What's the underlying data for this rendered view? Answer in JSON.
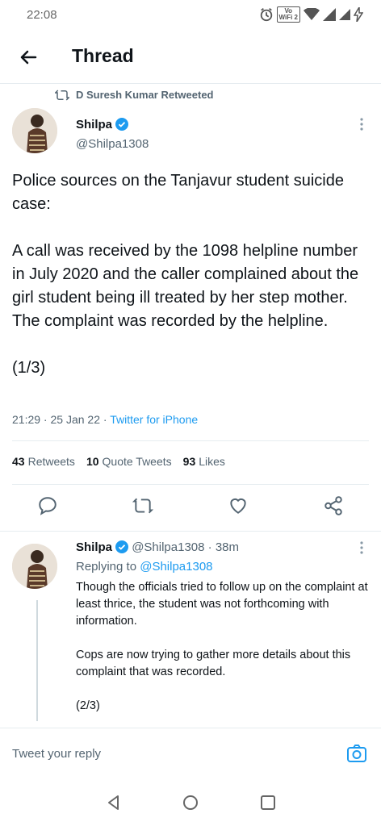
{
  "status_bar": {
    "time": "22:08",
    "volte_line1": "Vo",
    "volte_line2": "WiFi 2",
    "icons": [
      "alarm-icon",
      "volte-wifi-icon",
      "wifi-icon",
      "signal-icon",
      "signal-icon",
      "charging-icon"
    ]
  },
  "header": {
    "title": "Thread",
    "back_icon": "arrow-left-icon"
  },
  "main_tweet": {
    "retweeted_by": "D Suresh Kumar Retweeted",
    "author_name": "Shilpa",
    "author_handle": "@Shilpa1308",
    "paragraphs": [
      "Police sources on the Tanjavur student suicide case:",
      "A call was received by the 1098 helpline number in July 2020 and the caller complained about the girl student being ill treated by her step mother. The complaint was recorded by the helpline.",
      "(1/3)"
    ],
    "time": "21:29",
    "date": "25 Jan 22",
    "source": "Twitter for iPhone",
    "stats": {
      "retweets_count": "43",
      "retweets_label": "Retweets",
      "quotes_count": "10",
      "quotes_label": "Quote Tweets",
      "likes_count": "93",
      "likes_label": "Likes"
    },
    "action_icons": [
      "comment-icon",
      "retweet-icon",
      "like-icon",
      "share-icon"
    ]
  },
  "reply_tweet": {
    "author_name": "Shilpa",
    "author_handle": "@Shilpa1308",
    "age": "38m",
    "replying_prefix": "Replying to",
    "replying_to": "@Shilpa1308",
    "paragraphs": [
      "Though the officials tried to follow up on the complaint at least thrice, the student was not forthcoming with information.",
      "Cops are now trying to gather more details about this complaint that was recorded.",
      "(2/3)"
    ]
  },
  "reply_bar": {
    "placeholder": "Tweet your reply",
    "camera_icon": "camera-icon"
  },
  "nav_bar": {
    "icons": [
      "back-triangle-icon",
      "home-circle-icon",
      "recents-square-icon"
    ]
  },
  "colors": {
    "accent": "#1d9bf0",
    "text": "#0f1419",
    "secondary": "#536471",
    "divider": "#e6ecf0"
  }
}
